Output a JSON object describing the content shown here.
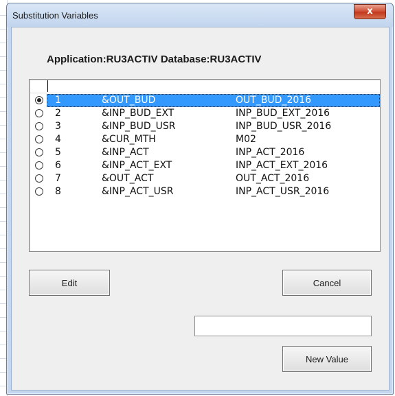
{
  "window": {
    "title": "Substitution Variables",
    "close_glyph": "x"
  },
  "header": {
    "label": "Application:RU3ACTIV Database:RU3ACTIV"
  },
  "list": {
    "rows": [
      {
        "num": "1",
        "name": "&OUT_BUD",
        "value": "OUT_BUD_2016",
        "selected": true
      },
      {
        "num": "2",
        "name": "&INP_BUD_EXT",
        "value": "INP_BUD_EXT_2016",
        "selected": false
      },
      {
        "num": "3",
        "name": "&INP_BUD_USR",
        "value": "INP_BUD_USR_2016",
        "selected": false
      },
      {
        "num": "4",
        "name": "&CUR_MTH",
        "value": "M02",
        "selected": false
      },
      {
        "num": "5",
        "name": "&INP_ACT",
        "value": "INP_ACT_2016",
        "selected": false
      },
      {
        "num": "6",
        "name": "&INP_ACT_EXT",
        "value": "INP_ACT_EXT_2016",
        "selected": false
      },
      {
        "num": "7",
        "name": "&OUT_ACT",
        "value": "OUT_ACT_2016",
        "selected": false
      },
      {
        "num": "8",
        "name": "&INP_ACT_USR",
        "value": "INP_ACT_USR_2016",
        "selected": false
      }
    ]
  },
  "buttons": {
    "edit": "Edit",
    "cancel": "Cancel",
    "new_value": "New Value"
  },
  "new_value_input": {
    "value": ""
  },
  "colors": {
    "selection": "#3399ff",
    "close_button": "#c2391d"
  }
}
